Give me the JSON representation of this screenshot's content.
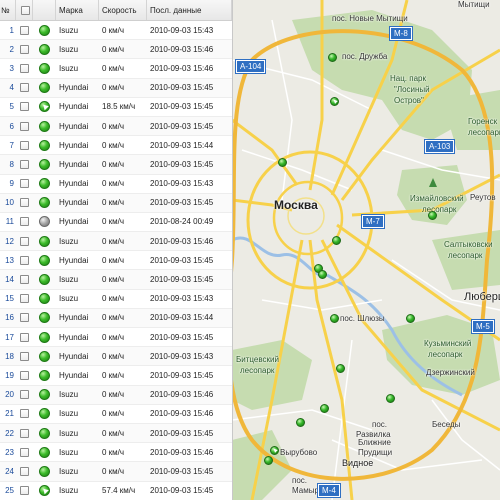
{
  "grid": {
    "headers": {
      "num": "№",
      "brand": "Марка",
      "speed": "Скорость",
      "date": "Посл. данные"
    },
    "rows": [
      {
        "num": "1",
        "status": "green",
        "brand": "Isuzu",
        "speed": "0 км/ч",
        "date": "2010-09-03 15:43"
      },
      {
        "num": "2",
        "status": "green",
        "brand": "Isuzu",
        "speed": "0 км/ч",
        "date": "2010-09-03 15:46"
      },
      {
        "num": "3",
        "status": "green",
        "brand": "Isuzu",
        "speed": "0 км/ч",
        "date": "2010-09-03 15:46"
      },
      {
        "num": "4",
        "status": "green",
        "brand": "Hyundai",
        "speed": "0 км/ч",
        "date": "2010-09-03 15:45"
      },
      {
        "num": "5",
        "status": "moving",
        "brand": "Hyundai",
        "speed": "18.5 км/ч",
        "date": "2010-09-03 15:45"
      },
      {
        "num": "6",
        "status": "green",
        "brand": "Hyundai",
        "speed": "0 км/ч",
        "date": "2010-09-03 15:45"
      },
      {
        "num": "7",
        "status": "green",
        "brand": "Hyundai",
        "speed": "0 км/ч",
        "date": "2010-09-03 15:44"
      },
      {
        "num": "8",
        "status": "green",
        "brand": "Hyundai",
        "speed": "0 км/ч",
        "date": "2010-09-03 15:45"
      },
      {
        "num": "9",
        "status": "green",
        "brand": "Hyundai",
        "speed": "0 км/ч",
        "date": "2010-09-03 15:43"
      },
      {
        "num": "10",
        "status": "green",
        "brand": "Hyundai",
        "speed": "0 км/ч",
        "date": "2010-09-03 15:45"
      },
      {
        "num": "11",
        "status": "gray",
        "brand": "Hyundai",
        "speed": "0 км/ч",
        "date": "2010-08-24 00:49"
      },
      {
        "num": "12",
        "status": "green",
        "brand": "Isuzu",
        "speed": "0 км/ч",
        "date": "2010-09-03 15:46"
      },
      {
        "num": "13",
        "status": "green",
        "brand": "Hyundai",
        "speed": "0 км/ч",
        "date": "2010-09-03 15:45"
      },
      {
        "num": "14",
        "status": "green",
        "brand": "Isuzu",
        "speed": "0 км/ч",
        "date": "2010-09-03 15:45"
      },
      {
        "num": "15",
        "status": "green",
        "brand": "Isuzu",
        "speed": "0 км/ч",
        "date": "2010-09-03 15:43"
      },
      {
        "num": "16",
        "status": "green",
        "brand": "Hyundai",
        "speed": "0 км/ч",
        "date": "2010-09-03 15:44"
      },
      {
        "num": "17",
        "status": "green",
        "brand": "Hyundai",
        "speed": "0 км/ч",
        "date": "2010-09-03 15:45"
      },
      {
        "num": "18",
        "status": "green",
        "brand": "Hyundai",
        "speed": "0 км/ч",
        "date": "2010-09-03 15:43"
      },
      {
        "num": "19",
        "status": "green",
        "brand": "Hyundai",
        "speed": "0 км/ч",
        "date": "2010-09-03 15:45"
      },
      {
        "num": "20",
        "status": "green",
        "brand": "Isuzu",
        "speed": "0 км/ч",
        "date": "2010-09-03 15:46"
      },
      {
        "num": "21",
        "status": "green",
        "brand": "Isuzu",
        "speed": "0 км/ч",
        "date": "2010-09-03 15:46"
      },
      {
        "num": "22",
        "status": "green",
        "brand": "Isuzu",
        "speed": "0 км/ч",
        "date": "2010-09-03 15:45"
      },
      {
        "num": "23",
        "status": "green",
        "brand": "Isuzu",
        "speed": "0 км/ч",
        "date": "2010-09-03 15:46"
      },
      {
        "num": "24",
        "status": "green",
        "brand": "Isuzu",
        "speed": "0 км/ч",
        "date": "2010-09-03 15:45"
      },
      {
        "num": "25",
        "status": "moving",
        "brand": "Isuzu",
        "speed": "57.4 км/ч",
        "date": "2010-09-03 15:45"
      }
    ]
  },
  "map": {
    "labels": {
      "city": "Москва",
      "mytishchi": "пос. Новые Мытищи",
      "druzhba": "пос. Дружба",
      "park_losiny_1": "Нац. парк",
      "park_losiny_2": "\"Лосиный",
      "park_losiny_3": "Остров\"",
      "gorenskiy_1": "Горенск",
      "gorenskiy_2": "лесопарк",
      "izmailovsky_1": "Измайловский",
      "izmailovsky_2": "лесопарк",
      "reutov": "Реутов",
      "saltykovsky_1": "Салтыковски",
      "saltykovsky_2": "лесопарк",
      "lyubertsy": "Люберц",
      "kuzminsky_1": "Кузьминский",
      "kuzminsky_2": "лесопарк",
      "dzerzhinsky": "Дзержинский",
      "shlyuzy": "пос. Шлюзы",
      "bitsevsky_1": "Битцевский",
      "bitsevsky_2": "лесопарк",
      "besedy": "Беседы",
      "razvilka_1": "пос.",
      "razvilka_2": "Развилка",
      "blizhnie_1": "Ближние",
      "blizhnie_2": "Прудищи",
      "vyrubovo": "Вырубово",
      "vidnoe": "Видное",
      "mamyri": "пос.",
      "mamyri_2": "Мамыри",
      "mytishchi_top": "Мытищи"
    },
    "shields": {
      "a104": "А-104",
      "m8": "М-8",
      "a103": "А-103",
      "m7": "М-7",
      "m5": "М-5",
      "m4": "М-4"
    },
    "colors": {
      "background": "#ecebe4",
      "park": "#c6dcb0",
      "major_road": "#f7d14a",
      "ring_road": "#f0b73a",
      "minor_road": "#ffffff",
      "water": "#9cc0e6",
      "shield": "#2f6fc2"
    }
  }
}
